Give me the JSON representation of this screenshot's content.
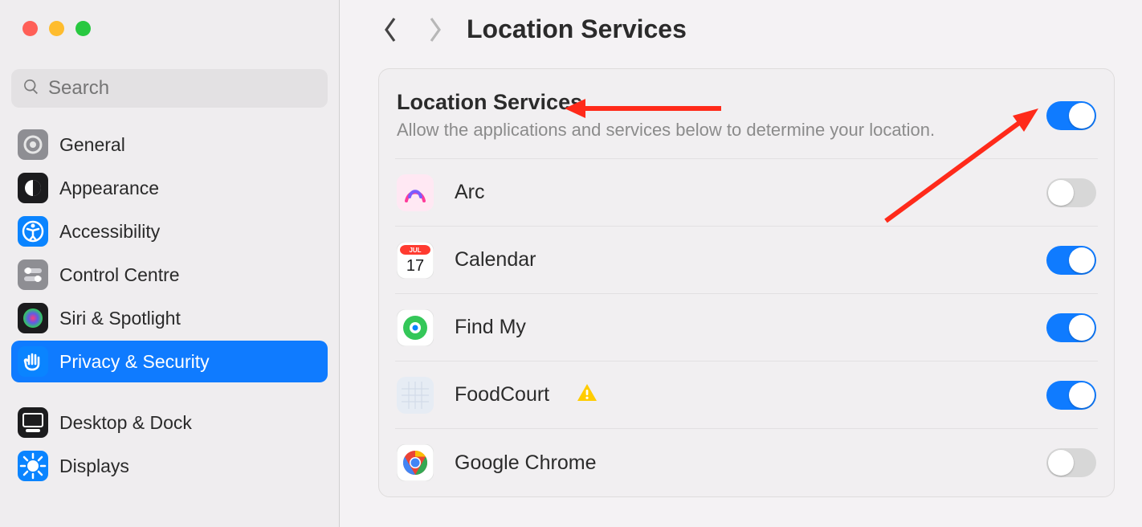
{
  "window": {
    "search_placeholder": "Search",
    "page_title": "Location Services"
  },
  "sidebar": {
    "items": [
      {
        "id": "general",
        "label": "General",
        "selected": false
      },
      {
        "id": "appearance",
        "label": "Appearance",
        "selected": false
      },
      {
        "id": "accessibility",
        "label": "Accessibility",
        "selected": false
      },
      {
        "id": "control-centre",
        "label": "Control Centre",
        "selected": false
      },
      {
        "id": "siri-spotlight",
        "label": "Siri & Spotlight",
        "selected": false
      },
      {
        "id": "privacy-security",
        "label": "Privacy & Security",
        "selected": true
      },
      {
        "id": "desktop-dock",
        "label": "Desktop & Dock",
        "selected": false
      },
      {
        "id": "displays",
        "label": "Displays",
        "selected": false
      }
    ]
  },
  "main": {
    "master": {
      "title": "Location Services",
      "description": "Allow the applications and services below to determine your location.",
      "enabled": true
    },
    "apps": [
      {
        "id": "arc",
        "name": "Arc",
        "enabled": false,
        "warning": false
      },
      {
        "id": "calendar",
        "name": "Calendar",
        "enabled": true,
        "warning": false
      },
      {
        "id": "findmy",
        "name": "Find My",
        "enabled": true,
        "warning": false
      },
      {
        "id": "foodcourt",
        "name": "FoodCourt",
        "enabled": true,
        "warning": true
      },
      {
        "id": "chrome",
        "name": "Google Chrome",
        "enabled": false,
        "warning": false
      }
    ]
  },
  "colors": {
    "accent": "#0f7bff",
    "annotation": "#ff2a1a"
  },
  "annotations": [
    {
      "type": "arrow",
      "target": "master-title"
    },
    {
      "type": "arrow",
      "target": "master-toggle"
    }
  ]
}
